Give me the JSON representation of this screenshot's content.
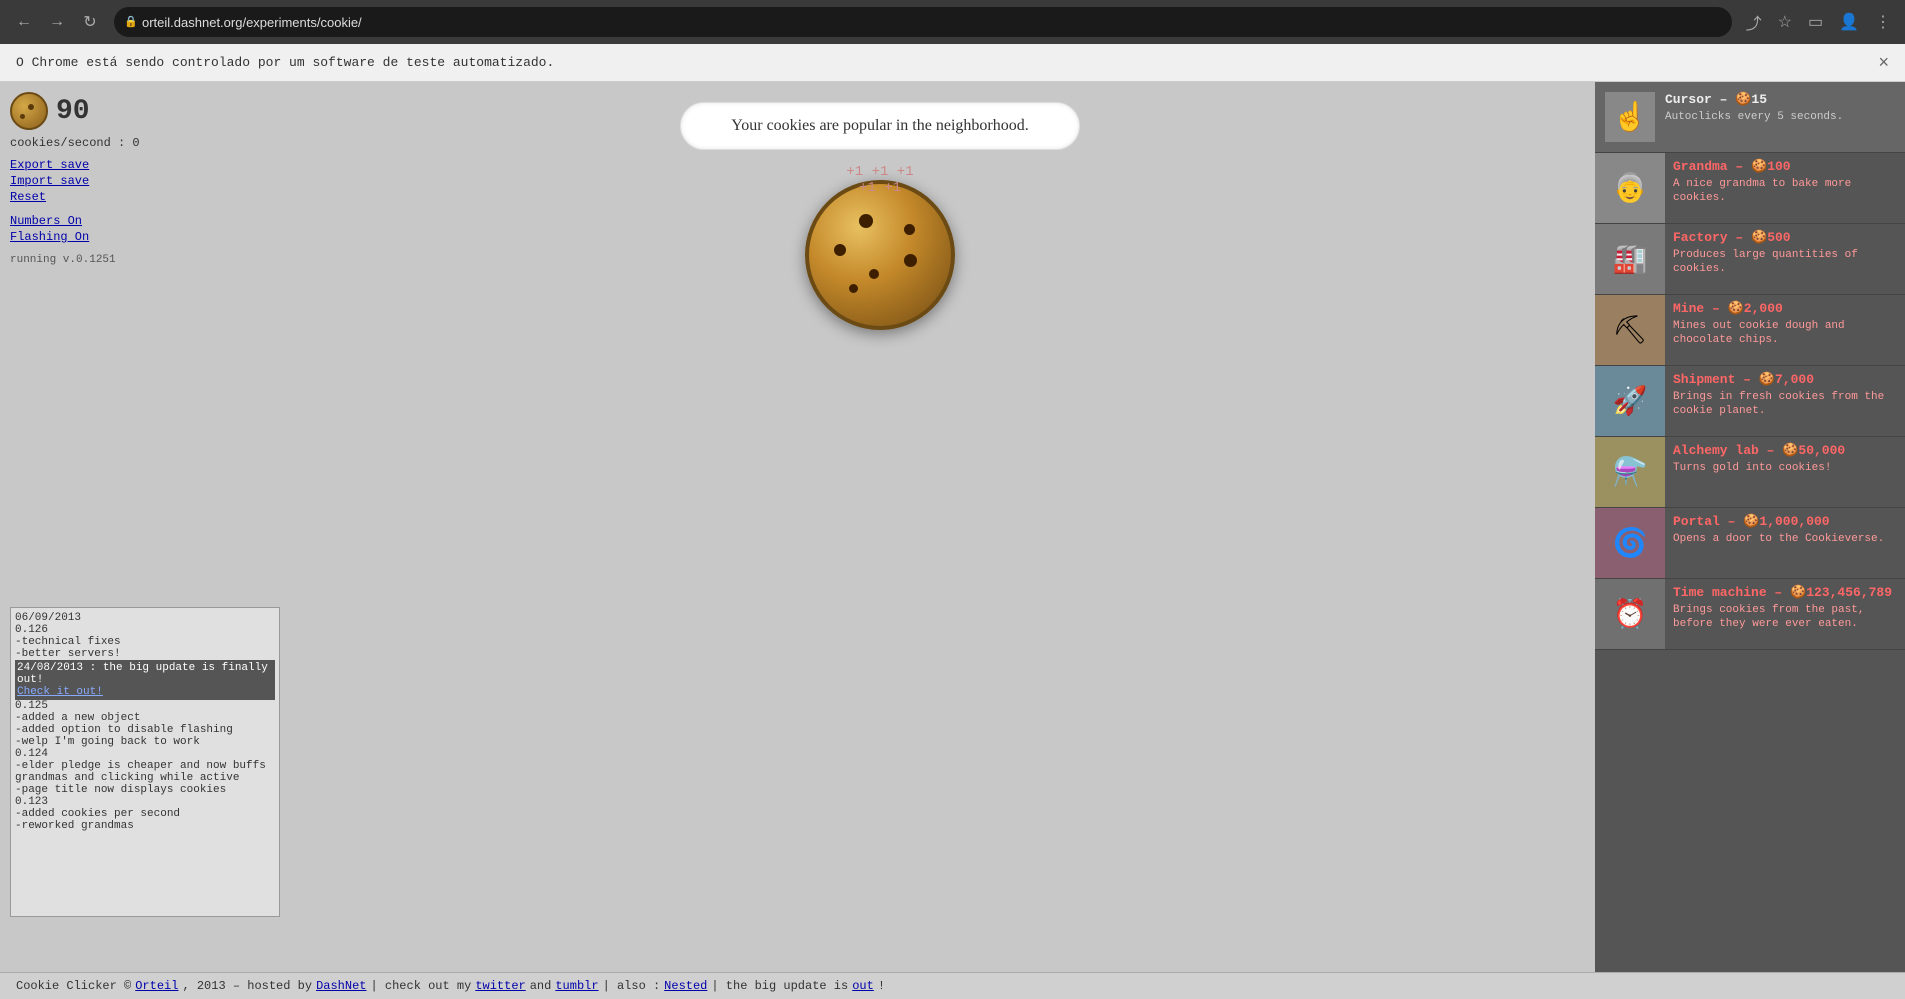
{
  "browser": {
    "url": "orteil.dashnet.org/experiments/cookie/",
    "back_btn": "←",
    "forward_btn": "→",
    "reload_btn": "↻",
    "automation_notice": "O Chrome está sendo controlado por um software de teste automatizado.",
    "close_label": "×"
  },
  "game": {
    "cookie_count": "90",
    "cookies_per_second": "cookies/second : 0",
    "export_save": "Export save",
    "import_save": "Import save",
    "reset": "Reset",
    "numbers_on": "Numbers On",
    "flashing_on": "Flashing On",
    "version": "running v.0.1251",
    "message": "Your cookies are popular\nin the neighborhood."
  },
  "cursor": {
    "title": "Cursor – 🍪15",
    "description": "Autoclicks every 5 seconds."
  },
  "shop_items": [
    {
      "name": "Grandma – 🍪100",
      "description": "A nice grandma to bake more cookies.",
      "emoji": "👵"
    },
    {
      "name": "Factory – 🍪500",
      "description": "Produces large quantities of cookies.",
      "emoji": "🏭"
    },
    {
      "name": "Mine – 🍪2,000",
      "description": "Mines out cookie dough and chocolate chips.",
      "emoji": "⛏"
    },
    {
      "name": "Shipment – 🍪7,000",
      "description": "Brings in fresh cookies from the cookie planet.",
      "emoji": "🚀"
    },
    {
      "name": "Alchemy lab – 🍪50,000",
      "description": "Turns gold into cookies!",
      "emoji": "⚗️"
    },
    {
      "name": "Portal – 🍪1,000,000",
      "description": "Opens a door to the Cookieverse.",
      "emoji": "🌀"
    },
    {
      "name": "Time machine – 🍪123,456,789",
      "description": "Brings cookies from the past, before they were ever eaten.",
      "emoji": "⏰"
    }
  ],
  "changelog": [
    {
      "text": "06/09/2013",
      "highlight": false
    },
    {
      "text": "0.126",
      "highlight": false
    },
    {
      "text": "-technical fixes",
      "highlight": false
    },
    {
      "text": "-better servers!",
      "highlight": false
    },
    {
      "text": "24/08/2013 : the big update is finally out!",
      "highlight": true,
      "link": "Check it out!"
    },
    {
      "text": "0.125",
      "highlight": false
    },
    {
      "text": "-added a new object",
      "highlight": false
    },
    {
      "text": "-added option to disable flashing",
      "highlight": false
    },
    {
      "text": "-welp I'm going back to work",
      "highlight": false
    },
    {
      "text": "0.124",
      "highlight": false
    },
    {
      "text": "-elder pledge is cheaper and now buffs grandmas and clicking while active",
      "highlight": false
    },
    {
      "text": "-page title now displays cookies",
      "highlight": false
    },
    {
      "text": "0.123",
      "highlight": false
    },
    {
      "text": "-added cookies per second",
      "highlight": false
    },
    {
      "text": "-reworked grandmas",
      "highlight": false
    }
  ],
  "footer": {
    "copyright": "Cookie Clicker © ",
    "orteil": "Orteil",
    "year": ", 2013 – hosted by ",
    "dashnet": "DashNet",
    "sep1": " | check out my ",
    "twitter": "twitter",
    "and": " and ",
    "tumblr": "tumblr",
    "sep2": " | also : ",
    "nested": "Nested",
    "sep3": " | the big update is ",
    "out": "out",
    "end": "!"
  }
}
